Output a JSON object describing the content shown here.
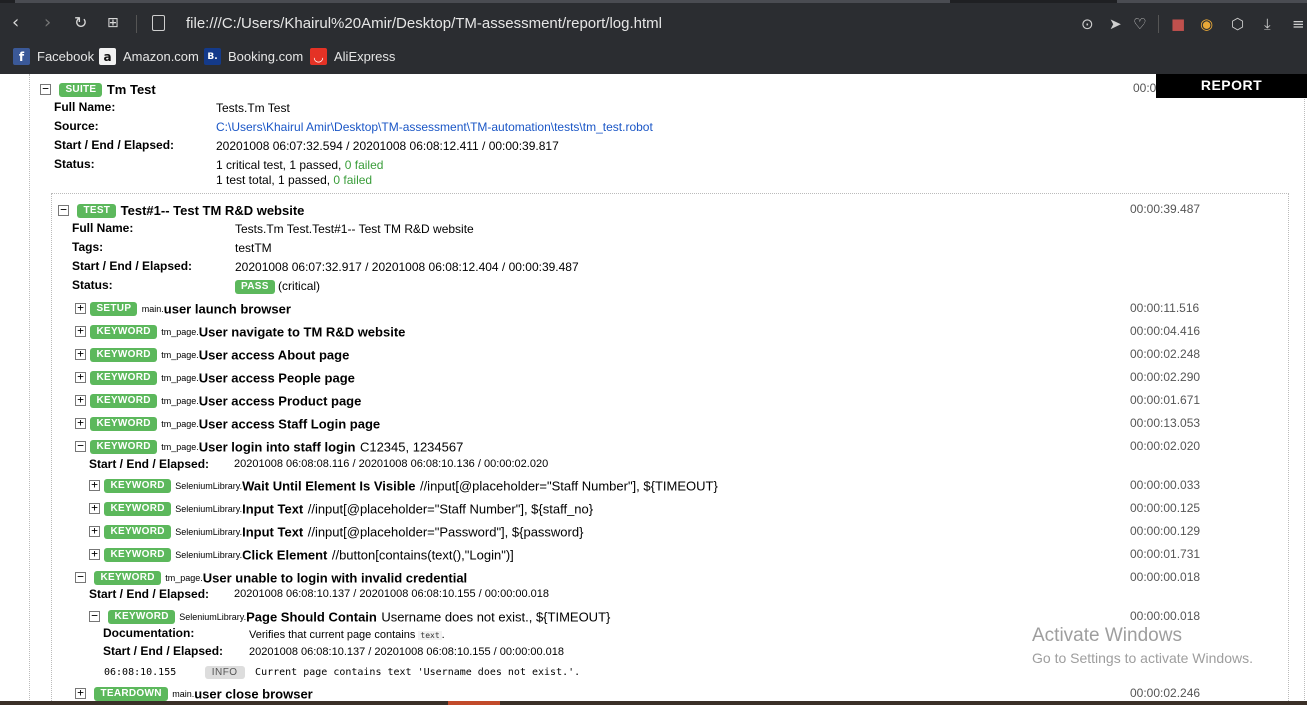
{
  "browser": {
    "url": "file:///C:/Users/Khairul%20Amir/Desktop/TM-assessment/report/log.html",
    "icons": [
      "back-icon",
      "forward-icon",
      "reload-icon",
      "tabs-grid-icon",
      "page-icon",
      "camera-icon",
      "send-icon",
      "heart-icon",
      "cube-icon",
      "download-icon",
      "menu-icon"
    ],
    "bookmarks": [
      {
        "label": "Facebook",
        "glyph": "f",
        "color": "#3b5998"
      },
      {
        "label": "Amazon.com",
        "glyph": "a",
        "color": "#f2f2f2"
      },
      {
        "label": "Booking.com",
        "glyph": "B.",
        "color": "#143a8a"
      },
      {
        "label": "AliExpress",
        "glyph": "◡",
        "color": "#e43225"
      }
    ]
  },
  "report_badge": "REPORT",
  "suite": {
    "label": "SUITE",
    "name": "Tm Test",
    "time_partial": "00:0",
    "meta": [
      {
        "label": "Full Name:",
        "value": "Tests.Tm Test"
      },
      {
        "label": "Source:",
        "value": "C:\\Users\\Khairul Amir\\Desktop\\TM-assessment\\TM-automation\\tests\\tm_test.robot"
      },
      {
        "label": "Start / End / Elapsed:",
        "value": "20201008 06:07:32.594 / 20201008 06:08:12.411 / 00:00:39.817"
      },
      {
        "label": "Status:",
        "value": ""
      }
    ],
    "status_line1_a": "1 critical test, 1 passed, ",
    "status_line1_b": "0 failed",
    "status_line2_a": "1 test total, 1 passed, ",
    "status_line2_b": "0 failed"
  },
  "test": {
    "label": "TEST",
    "name": "Test#1-- Test TM R&D website",
    "time": "00:00:39.487",
    "full_name_label": "Full Name:",
    "full_name": "Tests.Tm Test.Test#1-- Test TM R&D website",
    "tags_label": "Tags:",
    "tags": "testTM",
    "sel_label": "Start / End / Elapsed:",
    "sel": "20201008 06:07:32.917 / 20201008 06:08:12.404 / 00:00:39.487",
    "status_label": "Status:",
    "status_badge": "PASS",
    "status_text": "(critical)"
  },
  "keywords": [
    {
      "type": "SETUP",
      "lib": "main",
      "name": "user launch browser",
      "args": "",
      "time": "00:00:11.516",
      "toggle": "+"
    },
    {
      "type": "KEYWORD",
      "lib": "tm_page",
      "name": "User navigate to TM R&D website",
      "args": "",
      "time": "00:00:04.416",
      "toggle": "+"
    },
    {
      "type": "KEYWORD",
      "lib": "tm_page",
      "name": "User access About page",
      "args": "",
      "time": "00:00:02.248",
      "toggle": "+"
    },
    {
      "type": "KEYWORD",
      "lib": "tm_page",
      "name": "User access People page",
      "args": "",
      "time": "00:00:02.290",
      "toggle": "+"
    },
    {
      "type": "KEYWORD",
      "lib": "tm_page",
      "name": "User access Product page",
      "args": "",
      "time": "00:00:01.671",
      "toggle": "+"
    },
    {
      "type": "KEYWORD",
      "lib": "tm_page",
      "name": "User access Staff Login page",
      "args": "",
      "time": "00:00:13.053",
      "toggle": "+"
    },
    {
      "type": "KEYWORD",
      "lib": "tm_page",
      "name": "User login into staff login",
      "args": "C12345, 1234567",
      "time": "00:00:02.020",
      "toggle": "−"
    }
  ],
  "login_kw": {
    "sel_label": "Start / End / Elapsed:",
    "sel": "20201008 06:08:08.116 / 20201008 06:08:10.136 / 00:00:02.020",
    "children": [
      {
        "type": "KEYWORD",
        "lib": "SeleniumLibrary",
        "name": "Wait Until Element Is Visible",
        "args": "//input[@placeholder=\"Staff Number\"], ${TIMEOUT}",
        "time": "00:00:00.033"
      },
      {
        "type": "KEYWORD",
        "lib": "SeleniumLibrary",
        "name": "Input Text",
        "args": "//input[@placeholder=\"Staff Number\"], ${staff_no}",
        "time": "00:00:00.125"
      },
      {
        "type": "KEYWORD",
        "lib": "SeleniumLibrary",
        "name": "Input Text",
        "args": "//input[@placeholder=\"Password\"], ${password}",
        "time": "00:00:00.129"
      },
      {
        "type": "KEYWORD",
        "lib": "SeleniumLibrary",
        "name": "Click Element",
        "args": "//button[contains(text(),\"Login\")]",
        "time": "00:00:01.731"
      }
    ]
  },
  "invalid_kw": {
    "type": "KEYWORD",
    "lib": "tm_page",
    "name": "User unable to login with invalid credential",
    "time": "00:00:00.018",
    "sel_label": "Start / End / Elapsed:",
    "sel": "20201008 06:08:10.137 / 20201008 06:08:10.155 / 00:00:00.018",
    "child": {
      "type": "KEYWORD",
      "lib": "SeleniumLibrary",
      "name": "Page Should Contain",
      "args": "Username does not exist., ${TIMEOUT}",
      "time": "00:00:00.018",
      "doc_label": "Documentation:",
      "doc_text": "Verifies that current page contains ",
      "doc_code": "text",
      "doc_end": ".",
      "sel_label": "Start / End / Elapsed:",
      "sel": "20201008 06:08:10.137 / 20201008 06:08:10.155 / 00:00:00.018",
      "msg_time": "06:08:10.155",
      "msg_level": "INFO",
      "msg": "Current page contains text 'Username does not exist.'."
    }
  },
  "teardown": {
    "type": "TEARDOWN",
    "lib": "main",
    "name": "user close browser",
    "time": "00:00:02.246"
  },
  "watermark": {
    "line1": "Activate Windows",
    "line2": "Go to Settings to activate Windows."
  }
}
